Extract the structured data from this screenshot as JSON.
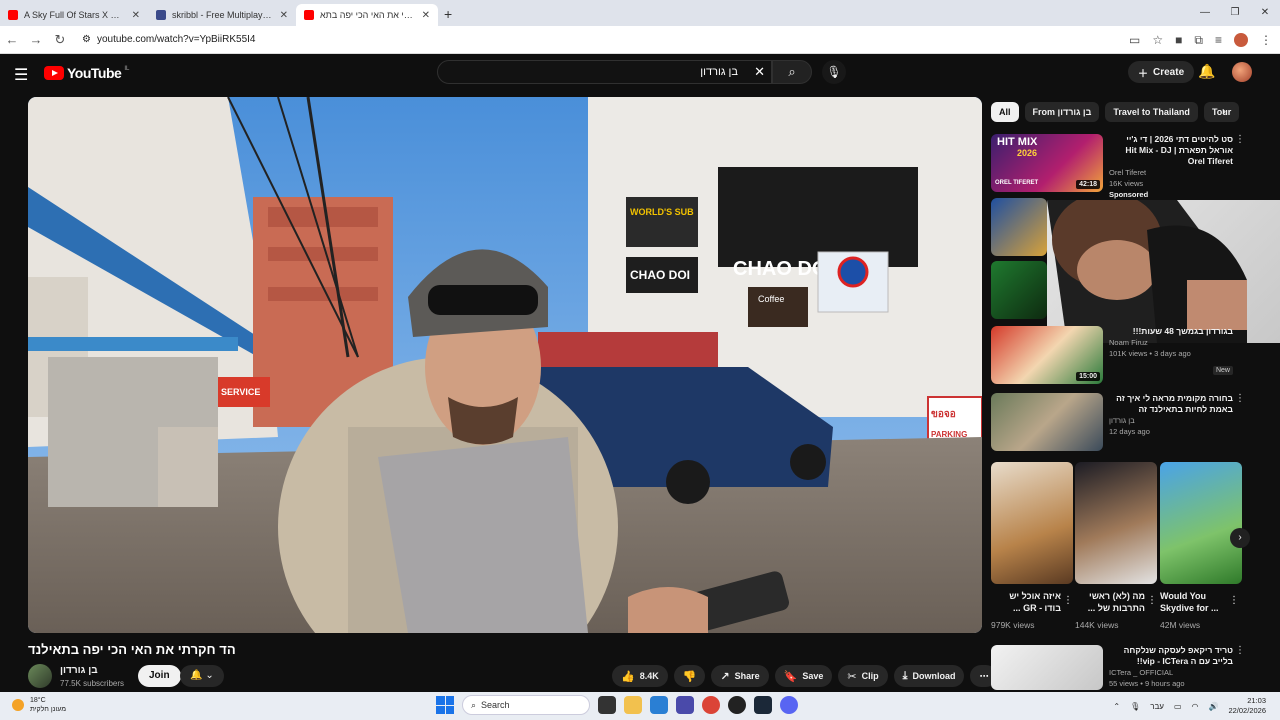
{
  "browser": {
    "tabs": [
      {
        "title": "A Sky Full Of Stars X Quevedo I",
        "fav_color": "#ff0000"
      },
      {
        "title": "skribbl - Free Multiplayer Drawi",
        "fav_color": "#3b4a8a"
      },
      {
        "title": "‫חקרתי את האי הכי יפה בתא‬",
        "fav_color": "#ff0000"
      }
    ],
    "new_tab": "+",
    "url": "youtube.com/watch?v=YpBiiRK55I4"
  },
  "header": {
    "logo_text": "YouTube",
    "logo_region": "IL",
    "search_query": "בן גורדון",
    "create_label": "Create"
  },
  "video": {
    "title": "הד חקרתי את האי הכי יפה בתאילנד",
    "channel": "בן גורדון",
    "subscribers": "77.5K subscribers",
    "join_label": "Join",
    "likes": "8.4K",
    "share_label": "Share",
    "save_label": "Save",
    "clip_label": "Clip",
    "download_label": "Download",
    "overlay_signs": {
      "sign1": "CHAO DOI",
      "sign2": "CHAO DOI",
      "sign3": "WORLD'S SUB",
      "sign4": "Coffee",
      "sign5": "PARKING",
      "sign6": "SERVICE",
      "plate": "ขอจอ"
    }
  },
  "chips": [
    "All",
    "From בן גורדון",
    "Travel to Thailand",
    "Tour"
  ],
  "recommendations": [
    {
      "title": "סט להיטים דתי 2026 | די ג'יי אוראל תפארת | Hit Mix - DJ Orel Tiferet",
      "channel": "Orel Tiferet",
      "views": "16K views",
      "extra": "Sponsored",
      "duration": "42:18"
    },
    {
      "title": "בגורדון בגמשך 48 שעות!!!",
      "channel": "Noam Firuz",
      "views": "101K views • 3 days ago",
      "extra": "New",
      "duration": "15:00"
    },
    {
      "title": "בחורה מקומית מראה לי איך זה באמת לחיות בתאילנד זה",
      "channel": "בן גורדון",
      "views": "12 days ago",
      "extra": "",
      "duration": ""
    },
    {
      "title": "טריד ריקאפ לעסקה שנלקחה בלייב עם ה vip - ICTera!!",
      "channel": "ICTera _ OFFICIAL",
      "views": "55 views • 9 hours ago",
      "extra": "",
      "duration": ""
    }
  ],
  "thumb_texts": {
    "hitmix": "HIT MIX",
    "hitmix_year": "2026",
    "orel": "OREL TIFERET"
  },
  "shorts": [
    {
      "caption": "איזה אוכל יש בודו - GR ...",
      "views": "979K views"
    },
    {
      "caption": "מה (לא) ראשי התרבות של ...",
      "views": "144K views"
    },
    {
      "caption": "Would You Skydive for ...",
      "views": "42M views"
    }
  ],
  "taskbar": {
    "temp": "18°C",
    "weather_text": "מעונן חלקית",
    "search_label": "Search",
    "lang": "עבר",
    "time": "21:03",
    "date": "22/02/2026"
  },
  "colors": {
    "yt_red": "#ff0000",
    "bg": "#0f0f0f",
    "pill": "#272727"
  }
}
